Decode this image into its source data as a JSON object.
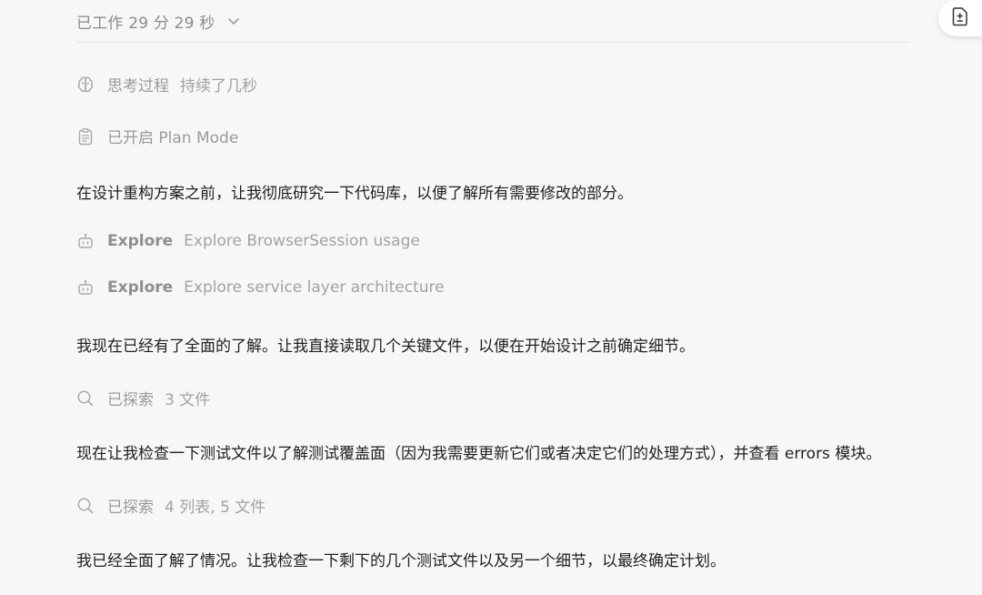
{
  "header": {
    "title": "已工作 29 分 29 秒"
  },
  "thinking": {
    "label": "思考过程",
    "duration": "持续了几秒"
  },
  "plan_mode": {
    "label": "已开启 Plan Mode"
  },
  "messages": {
    "m1": "在设计重构方案之前，让我彻底研究一下代码库，以便了解所有需要修改的部分。",
    "m2": "我现在已经有了全面的了解。让我直接读取几个关键文件，以便在开始设计之前确定细节。",
    "m3": "现在让我检查一下测试文件以了解测试覆盖面（因为我需要更新它们或者决定它们的处理方式），并查看 errors 模块。",
    "m4": "我已经全面了解了情况。让我检查一下剩下的几个测试文件以及另一个细节，以最终确定计划。"
  },
  "explore": [
    {
      "label": "Explore",
      "detail": "Explore BrowserSession usage"
    },
    {
      "label": "Explore",
      "detail": "Explore service layer architecture"
    }
  ],
  "explored": [
    {
      "label": "已探索",
      "detail": "3 文件"
    },
    {
      "label": "已探索",
      "detail": "4 列表, 5 文件"
    }
  ],
  "icons": {
    "chevron": "chevron-down-icon",
    "doc": "document-plus-icon",
    "brain": "brain-icon",
    "clipboard": "clipboard-icon",
    "robot": "robot-icon",
    "search": "search-icon"
  }
}
